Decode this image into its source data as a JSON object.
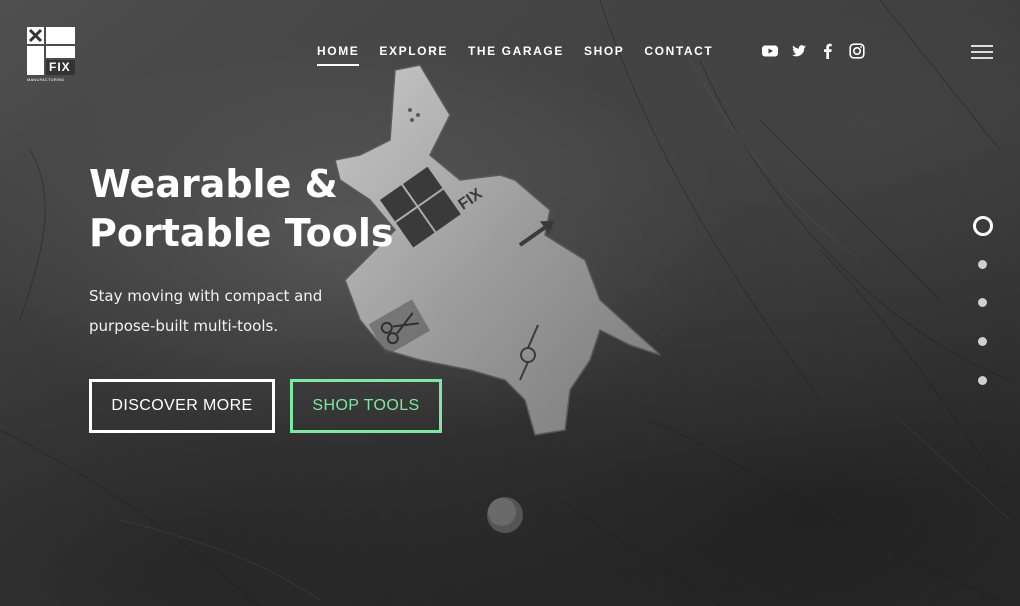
{
  "brand": {
    "logo_text": "FIX",
    "logo_subtext": "MANUFACTURING"
  },
  "nav": {
    "items": [
      {
        "label": "HOME",
        "active": true
      },
      {
        "label": "EXPLORE",
        "active": false
      },
      {
        "label": "THE GARAGE",
        "active": false
      },
      {
        "label": "SHOP",
        "active": false
      },
      {
        "label": "CONTACT",
        "active": false
      }
    ]
  },
  "social": [
    {
      "icon": "youtube-icon"
    },
    {
      "icon": "twitter-icon"
    },
    {
      "icon": "facebook-icon"
    },
    {
      "icon": "instagram-icon"
    }
  ],
  "hero": {
    "title_line1": "Wearable &",
    "title_line2": "Portable Tools",
    "subtitle_line1": "Stay moving with compact and",
    "subtitle_line2": "purpose-built multi-tools.",
    "primary_button": "DISCOVER MORE",
    "secondary_button": "SHOP TOOLS"
  },
  "slider": {
    "count": 5,
    "active_index": 0
  },
  "colors": {
    "accent": "#7ee8a2",
    "text": "#ffffff",
    "background": "#3d3d3d"
  }
}
